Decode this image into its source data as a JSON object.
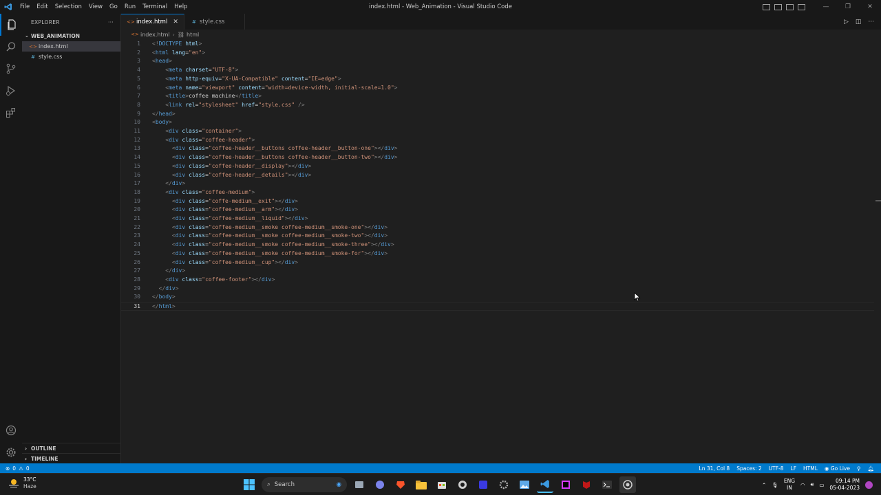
{
  "window": {
    "title": "index.html - Web_Animation - Visual Studio Code",
    "menu": [
      "File",
      "Edit",
      "Selection",
      "View",
      "Go",
      "Run",
      "Terminal",
      "Help"
    ]
  },
  "sidebar": {
    "title": "EXPLORER",
    "more": "···",
    "folder": "WEB_ANIMATION",
    "files": [
      {
        "name": "index.html",
        "type": "html",
        "selected": true
      },
      {
        "name": "style.css",
        "type": "css",
        "selected": false
      }
    ],
    "outline": "OUTLINE",
    "timeline": "TIMELINE"
  },
  "tabs": [
    {
      "label": "index.html",
      "active": true,
      "type": "html"
    },
    {
      "label": "style.css",
      "active": false,
      "type": "css"
    }
  ],
  "breadcrumb": {
    "file": "index.html",
    "symbol": "html"
  },
  "editor": {
    "current_line": 31,
    "lines": [
      [
        [
          "tg",
          "<!"
        ],
        [
          "tn",
          "DOCTYPE"
        ],
        [
          "tx",
          " "
        ],
        [
          "an",
          "html"
        ],
        [
          "tg",
          ">"
        ]
      ],
      [
        [
          "tg",
          "<"
        ],
        [
          "tn",
          "html"
        ],
        [
          "tx",
          " "
        ],
        [
          "an",
          "lang"
        ],
        [
          "tx",
          "="
        ],
        [
          "av",
          "\"en\""
        ],
        [
          "tg",
          ">"
        ]
      ],
      [
        [
          "tg",
          "<"
        ],
        [
          "tn",
          "head"
        ],
        [
          "tg",
          ">"
        ]
      ],
      [
        [
          "tx",
          "    "
        ],
        [
          "tg",
          "<"
        ],
        [
          "tn",
          "meta"
        ],
        [
          "tx",
          " "
        ],
        [
          "an",
          "charset"
        ],
        [
          "tx",
          "="
        ],
        [
          "av",
          "\"UTF-8\""
        ],
        [
          "tg",
          ">"
        ]
      ],
      [
        [
          "tx",
          "    "
        ],
        [
          "tg",
          "<"
        ],
        [
          "tn",
          "meta"
        ],
        [
          "tx",
          " "
        ],
        [
          "an",
          "http-equiv"
        ],
        [
          "tx",
          "="
        ],
        [
          "av",
          "\"X-UA-Compatible\""
        ],
        [
          "tx",
          " "
        ],
        [
          "an",
          "content"
        ],
        [
          "tx",
          "="
        ],
        [
          "av",
          "\"IE=edge\""
        ],
        [
          "tg",
          ">"
        ]
      ],
      [
        [
          "tx",
          "    "
        ],
        [
          "tg",
          "<"
        ],
        [
          "tn",
          "meta"
        ],
        [
          "tx",
          " "
        ],
        [
          "an",
          "name"
        ],
        [
          "tx",
          "="
        ],
        [
          "av",
          "\"viewport\""
        ],
        [
          "tx",
          " "
        ],
        [
          "an",
          "content"
        ],
        [
          "tx",
          "="
        ],
        [
          "av",
          "\"width=device-width, initial-scale=1.0\""
        ],
        [
          "tg",
          ">"
        ]
      ],
      [
        [
          "tx",
          "    "
        ],
        [
          "tg",
          "<"
        ],
        [
          "tn",
          "title"
        ],
        [
          "tg",
          ">"
        ],
        [
          "tx",
          "coffee machine"
        ],
        [
          "tg",
          "</"
        ],
        [
          "tn",
          "title"
        ],
        [
          "tg",
          ">"
        ]
      ],
      [
        [
          "tx",
          "    "
        ],
        [
          "tg",
          "<"
        ],
        [
          "tn",
          "link"
        ],
        [
          "tx",
          " "
        ],
        [
          "an",
          "rel"
        ],
        [
          "tx",
          "="
        ],
        [
          "av",
          "\"stylesheet\""
        ],
        [
          "tx",
          " "
        ],
        [
          "an",
          "href"
        ],
        [
          "tx",
          "="
        ],
        [
          "av",
          "\"style.css\""
        ],
        [
          "tx",
          " "
        ],
        [
          "tg",
          "/>"
        ]
      ],
      [
        [
          "tg",
          "</"
        ],
        [
          "tn",
          "head"
        ],
        [
          "tg",
          ">"
        ]
      ],
      [
        [
          "tg",
          "<"
        ],
        [
          "tn",
          "body"
        ],
        [
          "tg",
          ">"
        ]
      ],
      [
        [
          "tx",
          "    "
        ],
        [
          "tg",
          "<"
        ],
        [
          "tn",
          "div"
        ],
        [
          "tx",
          " "
        ],
        [
          "an",
          "class"
        ],
        [
          "tx",
          "="
        ],
        [
          "av",
          "\"container\""
        ],
        [
          "tg",
          ">"
        ]
      ],
      [
        [
          "tx",
          "    "
        ],
        [
          "tg",
          "<"
        ],
        [
          "tn",
          "div"
        ],
        [
          "tx",
          " "
        ],
        [
          "an",
          "class"
        ],
        [
          "tx",
          "="
        ],
        [
          "av",
          "\"coffee-header\""
        ],
        [
          "tg",
          ">"
        ]
      ],
      [
        [
          "tx",
          "      "
        ],
        [
          "tg",
          "<"
        ],
        [
          "tn",
          "div"
        ],
        [
          "tx",
          " "
        ],
        [
          "an",
          "class"
        ],
        [
          "tx",
          "="
        ],
        [
          "av",
          "\"coffee-header__buttons coffee-header__button-one\""
        ],
        [
          "tg",
          "></"
        ],
        [
          "tn",
          "div"
        ],
        [
          "tg",
          ">"
        ]
      ],
      [
        [
          "tx",
          "      "
        ],
        [
          "tg",
          "<"
        ],
        [
          "tn",
          "div"
        ],
        [
          "tx",
          " "
        ],
        [
          "an",
          "class"
        ],
        [
          "tx",
          "="
        ],
        [
          "av",
          "\"coffee-header__buttons coffee-header__button-two\""
        ],
        [
          "tg",
          "></"
        ],
        [
          "tn",
          "div"
        ],
        [
          "tg",
          ">"
        ]
      ],
      [
        [
          "tx",
          "      "
        ],
        [
          "tg",
          "<"
        ],
        [
          "tn",
          "div"
        ],
        [
          "tx",
          " "
        ],
        [
          "an",
          "class"
        ],
        [
          "tx",
          "="
        ],
        [
          "av",
          "\"coffee-header__display\""
        ],
        [
          "tg",
          "></"
        ],
        [
          "tn",
          "div"
        ],
        [
          "tg",
          ">"
        ]
      ],
      [
        [
          "tx",
          "      "
        ],
        [
          "tg",
          "<"
        ],
        [
          "tn",
          "div"
        ],
        [
          "tx",
          " "
        ],
        [
          "an",
          "class"
        ],
        [
          "tx",
          "="
        ],
        [
          "av",
          "\"coffee-header__details\""
        ],
        [
          "tg",
          "></"
        ],
        [
          "tn",
          "div"
        ],
        [
          "tg",
          ">"
        ]
      ],
      [
        [
          "tx",
          "    "
        ],
        [
          "tg",
          "</"
        ],
        [
          "tn",
          "div"
        ],
        [
          "tg",
          ">"
        ]
      ],
      [
        [
          "tx",
          "    "
        ],
        [
          "tg",
          "<"
        ],
        [
          "tn",
          "div"
        ],
        [
          "tx",
          " "
        ],
        [
          "an",
          "class"
        ],
        [
          "tx",
          "="
        ],
        [
          "av",
          "\"coffee-medium\""
        ],
        [
          "tg",
          ">"
        ]
      ],
      [
        [
          "tx",
          "      "
        ],
        [
          "tg",
          "<"
        ],
        [
          "tn",
          "div"
        ],
        [
          "tx",
          " "
        ],
        [
          "an",
          "class"
        ],
        [
          "tx",
          "="
        ],
        [
          "av",
          "\"coffe-medium__exit\""
        ],
        [
          "tg",
          "></"
        ],
        [
          "tn",
          "div"
        ],
        [
          "tg",
          ">"
        ]
      ],
      [
        [
          "tx",
          "      "
        ],
        [
          "tg",
          "<"
        ],
        [
          "tn",
          "div"
        ],
        [
          "tx",
          " "
        ],
        [
          "an",
          "class"
        ],
        [
          "tx",
          "="
        ],
        [
          "av",
          "\"coffee-medium__arm\""
        ],
        [
          "tg",
          "></"
        ],
        [
          "tn",
          "div"
        ],
        [
          "tg",
          ">"
        ]
      ],
      [
        [
          "tx",
          "      "
        ],
        [
          "tg",
          "<"
        ],
        [
          "tn",
          "div"
        ],
        [
          "tx",
          " "
        ],
        [
          "an",
          "class"
        ],
        [
          "tx",
          "="
        ],
        [
          "av",
          "\"coffee-medium__liquid\""
        ],
        [
          "tg",
          "></"
        ],
        [
          "tn",
          "div"
        ],
        [
          "tg",
          ">"
        ]
      ],
      [
        [
          "tx",
          "      "
        ],
        [
          "tg",
          "<"
        ],
        [
          "tn",
          "div"
        ],
        [
          "tx",
          " "
        ],
        [
          "an",
          "class"
        ],
        [
          "tx",
          "="
        ],
        [
          "av",
          "\"coffee-medium__smoke coffee-medium__smoke-one\""
        ],
        [
          "tg",
          "></"
        ],
        [
          "tn",
          "div"
        ],
        [
          "tg",
          ">"
        ]
      ],
      [
        [
          "tx",
          "      "
        ],
        [
          "tg",
          "<"
        ],
        [
          "tn",
          "div"
        ],
        [
          "tx",
          " "
        ],
        [
          "an",
          "class"
        ],
        [
          "tx",
          "="
        ],
        [
          "av",
          "\"coffee-medium__smoke coffee-medium__smoke-two\""
        ],
        [
          "tg",
          "></"
        ],
        [
          "tn",
          "div"
        ],
        [
          "tg",
          ">"
        ]
      ],
      [
        [
          "tx",
          "      "
        ],
        [
          "tg",
          "<"
        ],
        [
          "tn",
          "div"
        ],
        [
          "tx",
          " "
        ],
        [
          "an",
          "class"
        ],
        [
          "tx",
          "="
        ],
        [
          "av",
          "\"coffee-medium__smoke coffee-medium__smoke-three\""
        ],
        [
          "tg",
          "></"
        ],
        [
          "tn",
          "div"
        ],
        [
          "tg",
          ">"
        ]
      ],
      [
        [
          "tx",
          "      "
        ],
        [
          "tg",
          "<"
        ],
        [
          "tn",
          "div"
        ],
        [
          "tx",
          " "
        ],
        [
          "an",
          "class"
        ],
        [
          "tx",
          "="
        ],
        [
          "av",
          "\"coffee-medium__smoke coffee-medium__smoke-for\""
        ],
        [
          "tg",
          "></"
        ],
        [
          "tn",
          "div"
        ],
        [
          "tg",
          ">"
        ]
      ],
      [
        [
          "tx",
          "      "
        ],
        [
          "tg",
          "<"
        ],
        [
          "tn",
          "div"
        ],
        [
          "tx",
          " "
        ],
        [
          "an",
          "class"
        ],
        [
          "tx",
          "="
        ],
        [
          "av",
          "\"coffee-medium__cup\""
        ],
        [
          "tg",
          "></"
        ],
        [
          "tn",
          "div"
        ],
        [
          "tg",
          ">"
        ]
      ],
      [
        [
          "tx",
          "    "
        ],
        [
          "tg",
          "</"
        ],
        [
          "tn",
          "div"
        ],
        [
          "tg",
          ">"
        ]
      ],
      [
        [
          "tx",
          "    "
        ],
        [
          "tg",
          "<"
        ],
        [
          "tn",
          "div"
        ],
        [
          "tx",
          " "
        ],
        [
          "an",
          "class"
        ],
        [
          "tx",
          "="
        ],
        [
          "av",
          "\"coffee-footer\""
        ],
        [
          "tg",
          "></"
        ],
        [
          "tn",
          "div"
        ],
        [
          "tg",
          ">"
        ]
      ],
      [
        [
          "tx",
          "  "
        ],
        [
          "tg",
          "</"
        ],
        [
          "tn",
          "div"
        ],
        [
          "tg",
          ">"
        ]
      ],
      [
        [
          "tg",
          "</"
        ],
        [
          "tn",
          "body"
        ],
        [
          "tg",
          ">"
        ]
      ],
      [
        [
          "tg",
          "</"
        ],
        [
          "tn",
          "html"
        ],
        [
          "tg",
          ">"
        ]
      ]
    ]
  },
  "statusbar": {
    "errors": "0",
    "warnings": "0",
    "position": "Ln 31, Col 8",
    "spaces": "Spaces: 2",
    "encoding": "UTF-8",
    "eol": "LF",
    "language": "HTML",
    "golive": "Go Live"
  },
  "taskbar": {
    "temperature": "33°C",
    "condition": "Haze",
    "search_label": "Search",
    "lang_top": "ENG",
    "lang_bottom": "IN",
    "time": "09:14 PM",
    "date": "05-04-2023"
  },
  "colors": {
    "accent": "#0078d4",
    "statusbar": "#007acc",
    "tag": "#569cd6",
    "attr_name": "#9cdcfe",
    "attr_value": "#ce9178"
  }
}
